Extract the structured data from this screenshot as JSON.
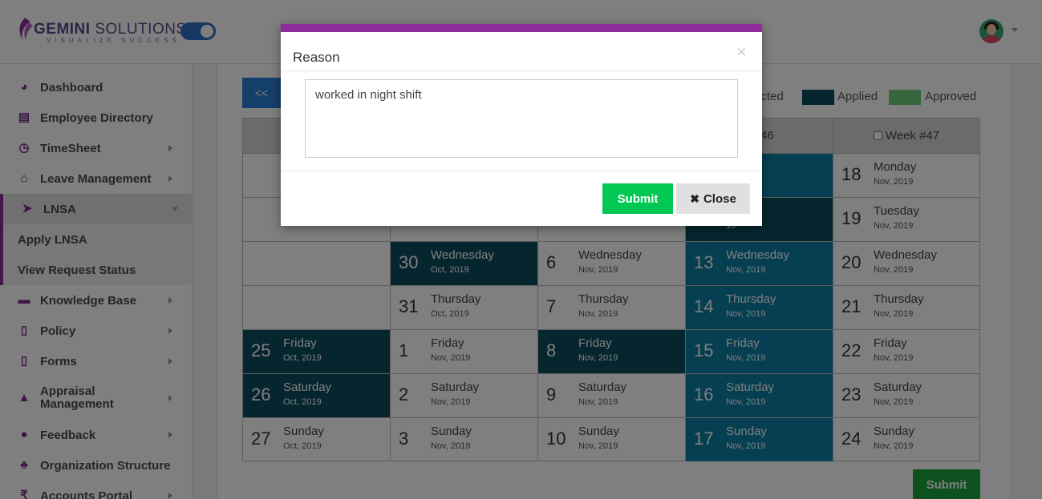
{
  "brand": {
    "name_bold": "GEMINI",
    "name_rest": " SOLUTIONS",
    "tagline": "VISUALIZE SUCCESS",
    "accent_color": "#8e2b9b"
  },
  "sidebar": {
    "items": [
      {
        "label": "Dashboard",
        "icon": "dashboard-icon",
        "glyph": "◕",
        "has_arrow": false
      },
      {
        "label": "Employee Directory",
        "icon": "address-book-icon",
        "glyph": "▤",
        "has_arrow": false
      },
      {
        "label": "TimeSheet",
        "icon": "clock-icon",
        "glyph": "◷",
        "has_arrow": true
      },
      {
        "label": "Leave Management",
        "icon": "home-icon",
        "glyph": "⌂",
        "has_arrow": true
      },
      {
        "label": "LNSA",
        "icon": "paper-plane-icon",
        "glyph": "➤",
        "has_arrow": true,
        "active": true
      },
      {
        "label": "Knowledge Base",
        "icon": "folder-icon",
        "glyph": "▬",
        "has_arrow": true
      },
      {
        "label": "Policy",
        "icon": "file-icon",
        "glyph": "▯",
        "has_arrow": true
      },
      {
        "label": "Forms",
        "icon": "file-text-icon",
        "glyph": "▯",
        "has_arrow": true
      },
      {
        "label": "Appraisal Management",
        "icon": "graduation-cap-icon",
        "glyph": "▲",
        "has_arrow": true
      },
      {
        "label": "Feedback",
        "icon": "comments-icon",
        "glyph": "●",
        "has_arrow": true
      },
      {
        "label": "Organization Structure",
        "icon": "sitemap-icon",
        "glyph": "♣",
        "has_arrow": false
      },
      {
        "label": "Accounts Portal",
        "icon": "rupee-icon",
        "glyph": "₹",
        "has_arrow": true
      }
    ],
    "sub_items": [
      "Apply LNSA",
      "View Request Status"
    ]
  },
  "calendar": {
    "prev_label": "<<",
    "legend": [
      {
        "label": "ected",
        "color": null
      },
      {
        "label": "Applied",
        "color": "#0b4a5e"
      },
      {
        "label": "Approved",
        "color": "#6fcf7a"
      }
    ],
    "week_headers": [
      "",
      "",
      "",
      "k #46",
      "Week #47"
    ],
    "columns": [
      [
        null,
        null,
        null,
        null,
        {
          "num": "25",
          "day": "Friday",
          "mon": "Oct, 2019",
          "state": "dark"
        },
        {
          "num": "26",
          "day": "Saturday",
          "mon": "Oct, 2019",
          "state": "dark"
        },
        {
          "num": "27",
          "day": "Sunday",
          "mon": "Oct, 2019",
          "state": "none"
        }
      ],
      [
        null,
        null,
        {
          "num": "30",
          "day": "Wednesday",
          "mon": "Oct, 2019",
          "state": "dark"
        },
        {
          "num": "31",
          "day": "Thursday",
          "mon": "Oct, 2019",
          "state": "none"
        },
        {
          "num": "1",
          "day": "Friday",
          "mon": "Nov, 2019",
          "state": "none"
        },
        {
          "num": "2",
          "day": "Saturday",
          "mon": "Nov, 2019",
          "state": "none"
        },
        {
          "num": "3",
          "day": "Sunday",
          "mon": "Nov, 2019",
          "state": "none"
        }
      ],
      [
        null,
        null,
        {
          "num": "6",
          "day": "Wednesday",
          "mon": "Nov, 2019",
          "state": "none"
        },
        {
          "num": "7",
          "day": "Thursday",
          "mon": "Nov, 2019",
          "state": "none"
        },
        {
          "num": "8",
          "day": "Friday",
          "mon": "Nov, 2019",
          "state": "dark"
        },
        {
          "num": "9",
          "day": "Saturday",
          "mon": "Nov, 2019",
          "state": "none"
        },
        {
          "num": "10",
          "day": "Sunday",
          "mon": "Nov, 2019",
          "state": "none"
        }
      ],
      [
        {
          "num": "",
          "day": "ay",
          "mon": "19",
          "state": "mid"
        },
        {
          "num": "",
          "day": "ay",
          "mon": "19",
          "state": "dark"
        },
        {
          "num": "13",
          "day": "Wednesday",
          "mon": "Nov, 2019",
          "state": "mid"
        },
        {
          "num": "14",
          "day": "Thursday",
          "mon": "Nov, 2019",
          "state": "mid"
        },
        {
          "num": "15",
          "day": "Friday",
          "mon": "Nov, 2019",
          "state": "mid"
        },
        {
          "num": "16",
          "day": "Saturday",
          "mon": "Nov, 2019",
          "state": "mid"
        },
        {
          "num": "17",
          "day": "Sunday",
          "mon": "Nov, 2019",
          "state": "mid"
        }
      ],
      [
        {
          "num": "18",
          "day": "Monday",
          "mon": "Nov, 2019",
          "state": "none"
        },
        {
          "num": "19",
          "day": "Tuesday",
          "mon": "Nov, 2019",
          "state": "none"
        },
        {
          "num": "20",
          "day": "Wednesday",
          "mon": "Nov, 2019",
          "state": "none"
        },
        {
          "num": "21",
          "day": "Thursday",
          "mon": "Nov, 2019",
          "state": "none"
        },
        {
          "num": "22",
          "day": "Friday",
          "mon": "Nov, 2019",
          "state": "none"
        },
        {
          "num": "23",
          "day": "Saturday",
          "mon": "Nov, 2019",
          "state": "none"
        },
        {
          "num": "24",
          "day": "Sunday",
          "mon": "Nov, 2019",
          "state": "none"
        }
      ]
    ],
    "submit_label": "Submit"
  },
  "modal": {
    "title": "Reason",
    "reason_text": "worked in night shift",
    "submit_label": "Submit",
    "close_label": "Close",
    "close_glyph": "✖",
    "dismiss_glyph": "×"
  }
}
